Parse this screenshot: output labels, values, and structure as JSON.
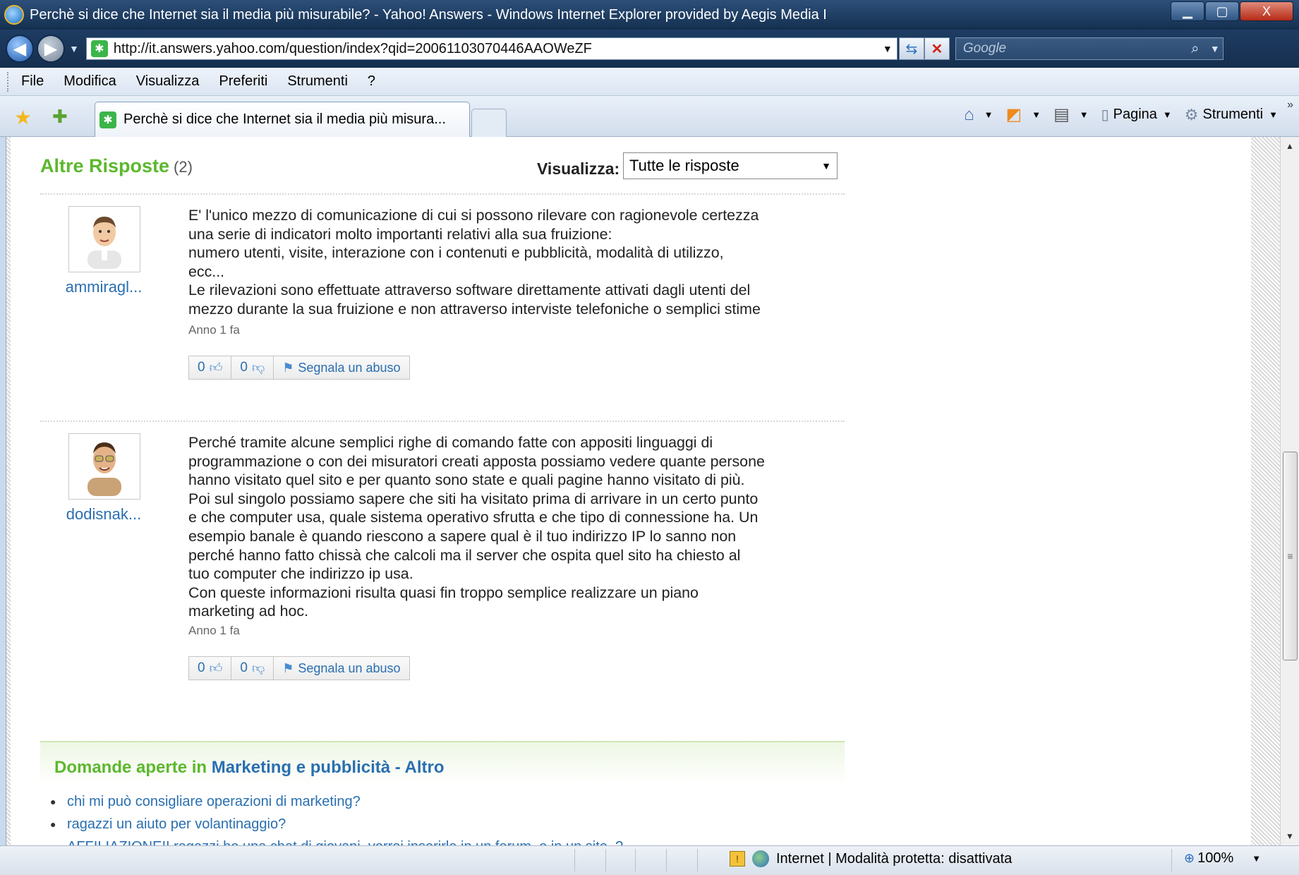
{
  "window": {
    "title": "Perchè si dice che Internet sia il media più misurabile? - Yahoo! Answers - Windows Internet Explorer provided by Aegis Media I",
    "minimize": "▁",
    "maximize": "▢",
    "close": "X"
  },
  "address_bar": {
    "url": "http://it.answers.yahoo.com/question/index?qid=20061103070446AAOWeZF",
    "search_placeholder": "Google"
  },
  "menu": {
    "items": [
      "File",
      "Modifica",
      "Visualizza",
      "Preferiti",
      "Strumenti",
      "?"
    ]
  },
  "tabs": {
    "active_tab_label": "Perchè si dice che Internet sia il media più misura...",
    "commands": {
      "page": "Pagina",
      "tools": "Strumenti"
    }
  },
  "answers": {
    "title": "Altre Risposte",
    "count": "(2)",
    "view_label": "Visualizza:",
    "view_selected": "Tutte le risposte",
    "items": [
      {
        "username": "ammiragl...",
        "lines": [
          "E' l'unico mezzo di comunicazione di cui si possono rilevare con ragionevole certezza",
          "una serie di indicatori molto importanti relativi alla sua fruizione:",
          "numero utenti, visite, interazione con i contenuti e pubblicità, modalità di utilizzo,",
          "ecc...",
          "Le rilevazioni sono effettuate attraverso software direttamente attivati dagli utenti del",
          "mezzo durante la sua fruizione e non attraverso interviste telefoniche o semplici stime"
        ],
        "age": "Anno 1 fa",
        "thumbs_up": "0",
        "thumbs_down": "0",
        "report": "Segnala un abuso"
      },
      {
        "username": "dodisnak...",
        "lines": [
          "Perché tramite alcune semplici righe di comando fatte con appositi linguaggi di",
          "programmazione o con dei misuratori creati apposta possiamo vedere quante persone",
          "hanno visitato quel sito e per quanto sono state e quali pagine hanno visitato di più.",
          "Poi sul singolo possiamo sapere che siti ha visitato prima di arrivare in un certo punto",
          "e che computer usa, quale sistema operativo sfrutta e che tipo di connessione ha. Un",
          "esempio banale è quando riescono a sapere qual è il tuo indirizzo IP lo sanno non",
          "perché hanno fatto chissà che calcoli ma il server che ospita quel sito ha chiesto al",
          "tuo computer che indirizzo ip usa.",
          "Con queste informazioni risulta quasi fin troppo semplice realizzare un piano",
          "marketing ad hoc."
        ],
        "age": "Anno 1 fa",
        "thumbs_up": "0",
        "thumbs_down": "0",
        "report": "Segnala un abuso"
      }
    ]
  },
  "open_questions": {
    "prefix": "Domande aperte in",
    "category": "Marketing e pubblicità - Altro",
    "items": [
      "chi mi può consigliare operazioni di marketing?",
      "ragazzi un aiuto per volantinaggio?",
      "AFFILIAZIONE!! ragazzi ho una chat di giovani, vorrei inserirla in un forum, o in un sito..?"
    ]
  },
  "status_bar": {
    "zone": "Internet | Modalità protetta: disattivata",
    "zoom": "100%"
  },
  "colors": {
    "accent_green": "#5cb82d",
    "link_blue": "#2a6fb0"
  },
  "icons": [
    "ie-icon",
    "back-arrow-icon",
    "forward-arrow-icon",
    "page-favicon",
    "refresh-icon",
    "stop-icon",
    "search-icon",
    "favorites-star-icon",
    "add-favorites-icon",
    "home-icon",
    "feed-icon",
    "print-icon",
    "page-icon",
    "tools-gear-icon",
    "thumbs-up-icon",
    "thumbs-down-icon",
    "flag-icon",
    "protected-mode-icon",
    "globe-icon",
    "zoom-icon"
  ]
}
